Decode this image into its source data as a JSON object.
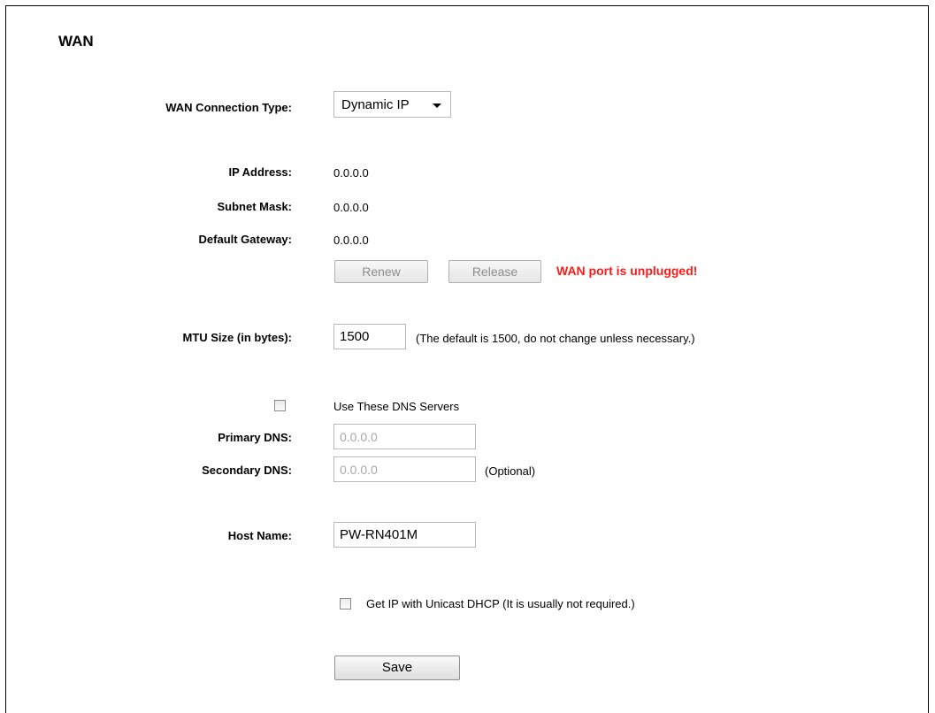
{
  "page": {
    "title": "WAN"
  },
  "connection": {
    "label": "WAN Connection Type:",
    "selected": "Dynamic IP"
  },
  "status": {
    "ip_label": "IP Address:",
    "ip_value": "0.0.0.0",
    "mask_label": "Subnet Mask:",
    "mask_value": "0.0.0.0",
    "gateway_label": "Default Gateway:",
    "gateway_value": "0.0.0.0"
  },
  "actions": {
    "renew": "Renew",
    "release": "Release",
    "warning": "WAN port is unplugged!",
    "warning_color": "#ff1a1a"
  },
  "mtu": {
    "label": "MTU Size (in bytes):",
    "value": "1500",
    "hint": "(The default is 1500, do not change unless necessary.)"
  },
  "dns": {
    "use_label": "Use These DNS Servers",
    "use_checked": false,
    "primary_label": "Primary DNS:",
    "primary_value": "0.0.0.0",
    "secondary_label": "Secondary DNS:",
    "secondary_value": "0.0.0.0",
    "optional": "(Optional)"
  },
  "host": {
    "label": "Host Name:",
    "value": "PW-RN401M"
  },
  "unicast": {
    "label": "Get IP with Unicast DHCP (It is usually not required.)",
    "checked": false
  },
  "save": {
    "label": "Save"
  }
}
